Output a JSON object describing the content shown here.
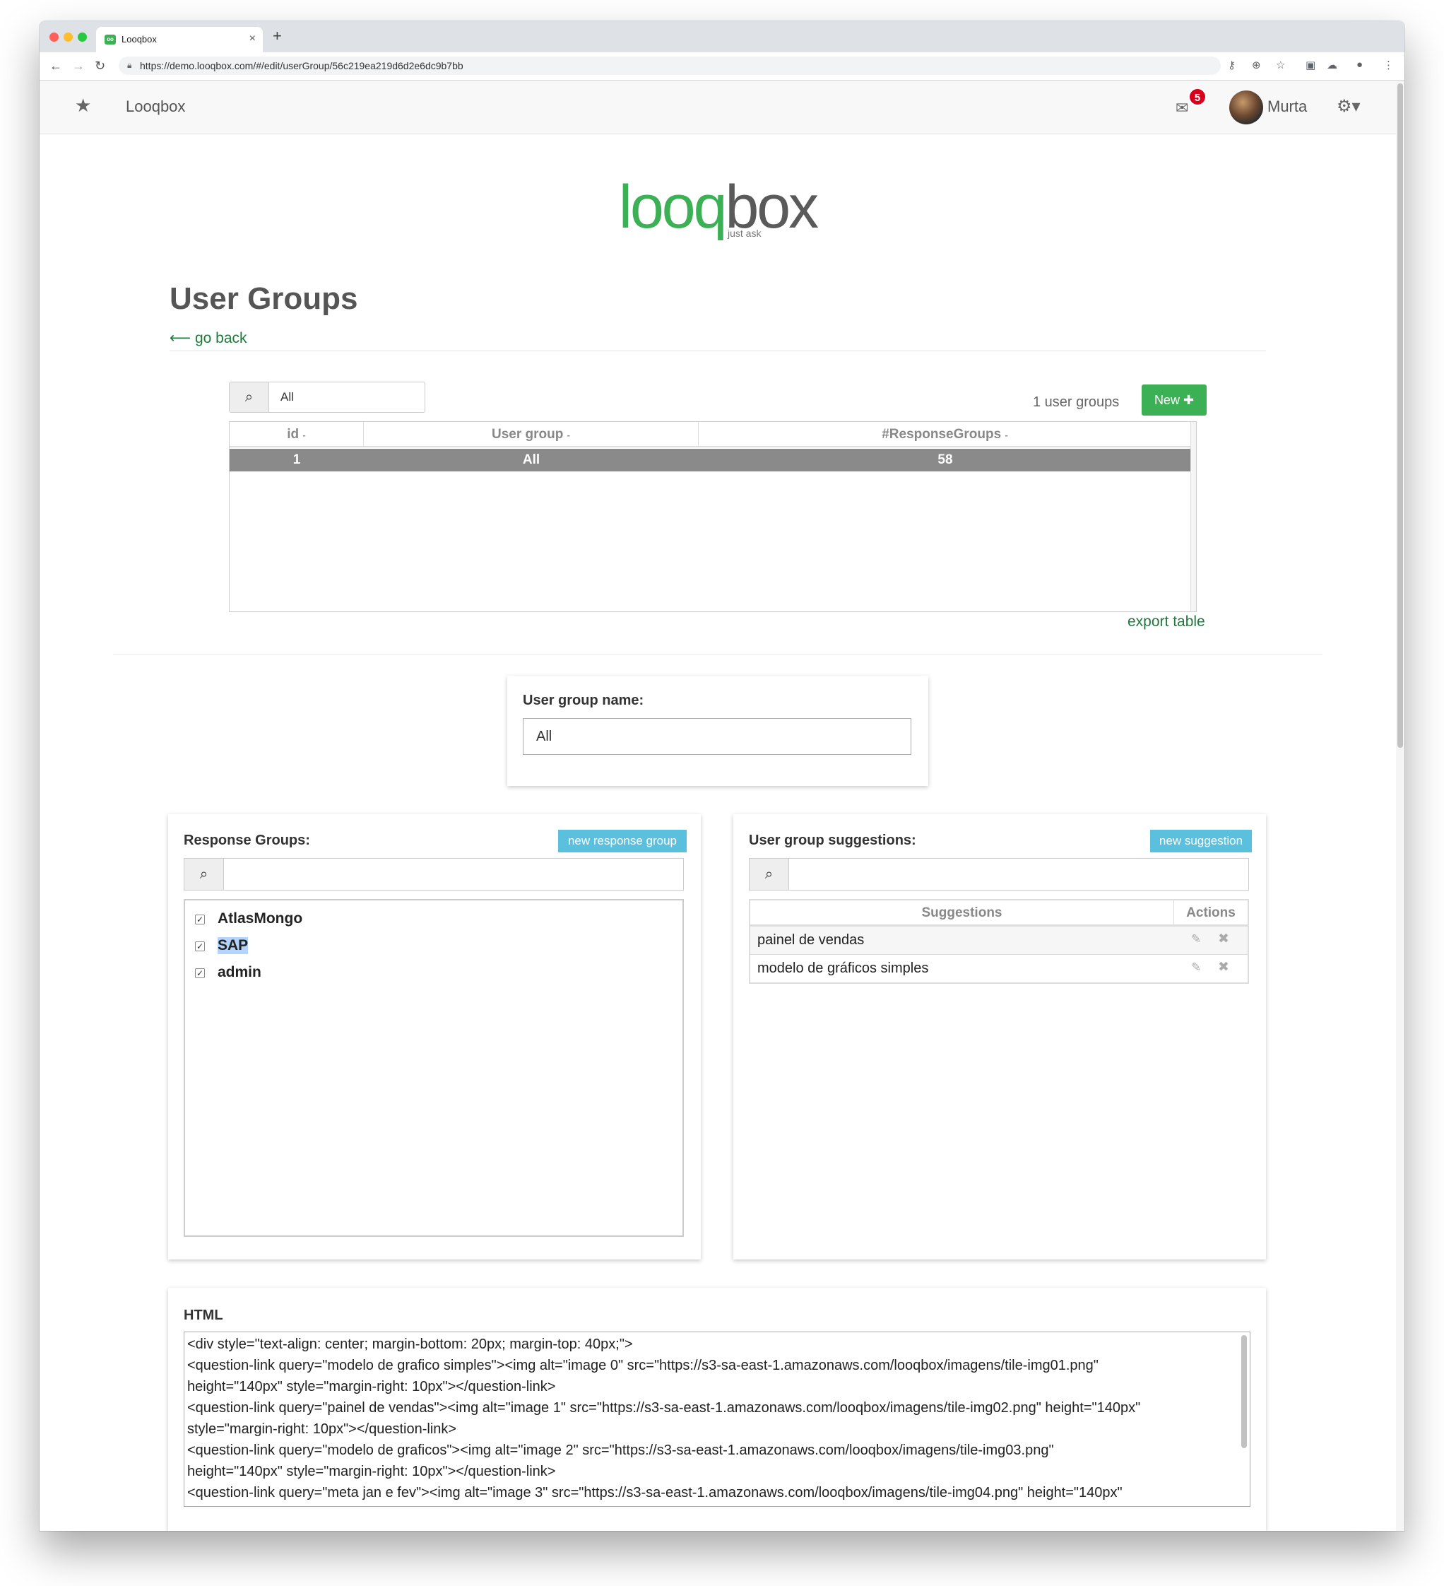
{
  "browser": {
    "tab_title": "Looqbox",
    "tab_close": "×",
    "new_tab": "+",
    "url": "https://demo.looqbox.com/#/edit/userGroup/56c219ea219d6d2e6dc9b7bb",
    "icons": [
      "back-icon",
      "forward-icon",
      "reload-icon",
      "lock-icon",
      "key-icon",
      "zoom-icon",
      "bookmark-star-icon",
      "extension-icon",
      "cloud-icon",
      "profile-icon",
      "menu-icon"
    ]
  },
  "navbar": {
    "brand": "Looqbox",
    "notifications": "5",
    "user_name": "Murta"
  },
  "logo": {
    "part1": "looq",
    "part2": "box",
    "tagline": "just ask",
    "colors": {
      "green": "#3cb054",
      "gray": "#5a5a5a"
    }
  },
  "page": {
    "title": "User Groups",
    "go_back": "go back"
  },
  "list": {
    "filter_value": "All",
    "count_label": "1 user groups",
    "new_button": "New",
    "columns": [
      "id",
      "User group",
      "#ResponseGroups"
    ],
    "sort_indicator": "-",
    "rows": [
      {
        "id": "1",
        "user_group": "All",
        "response_groups": "58"
      }
    ],
    "export_label": "export table"
  },
  "form": {
    "name_label": "User group name:",
    "name_value": "All"
  },
  "response_groups": {
    "label": "Response Groups:",
    "new_button": "new response group",
    "search_value": "",
    "items": [
      {
        "label": "AtlasMongo",
        "checked": true,
        "highlighted": false
      },
      {
        "label": "SAP",
        "checked": true,
        "highlighted": true
      },
      {
        "label": "admin",
        "checked": true,
        "highlighted": false
      }
    ]
  },
  "suggestions": {
    "label": "User group suggestions:",
    "new_button": "new suggestion",
    "search_value": "",
    "columns": [
      "Suggestions",
      "Actions"
    ],
    "rows": [
      "painel de vendas",
      "modelo de gráficos simples"
    ]
  },
  "html_section": {
    "label": "HTML",
    "lines": [
      "<div style=\"text-align: center; margin-bottom: 20px; margin-top: 40px;\">",
      "    <question-link query=\"modelo de grafico simples\"><img alt=\"image 0\" src=\"https://s3-sa-east-1.amazonaws.com/looqbox/imagens/tile-img01.png\"",
      "height=\"140px\" style=\"margin-right: 10px\"></question-link>",
      "    <question-link query=\"painel de vendas\"><img alt=\"image 1\" src=\"https://s3-sa-east-1.amazonaws.com/looqbox/imagens/tile-img02.png\" height=\"140px\"",
      "style=\"margin-right: 10px\"></question-link>",
      "    <question-link query=\"modelo de graficos\"><img alt=\"image 2\" src=\"https://s3-sa-east-1.amazonaws.com/looqbox/imagens/tile-img03.png\"",
      "height=\"140px\" style=\"margin-right: 10px\"></question-link>",
      "    <question-link query=\"meta jan e fev\"><img alt=\"image 3\" src=\"https://s3-sa-east-1.amazonaws.com/looqbox/imagens/tile-img04.png\" height=\"140px\""
    ]
  }
}
